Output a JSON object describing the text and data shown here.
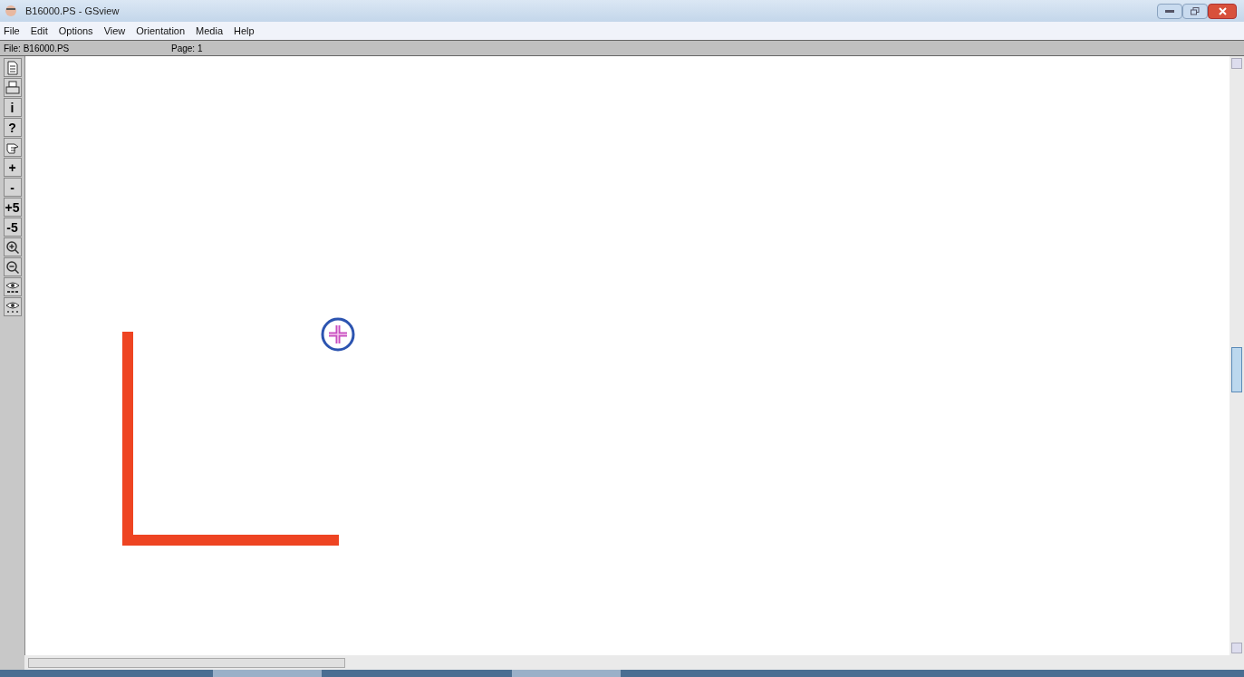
{
  "window": {
    "title": "B16000.PS - GSview"
  },
  "menu": [
    "File",
    "Edit",
    "Options",
    "View",
    "Orientation",
    "Media",
    "Help"
  ],
  "status_bar": {
    "file": "File: B16000.PS",
    "page": "Page: 1"
  },
  "toolbar": [
    {
      "kind": "icon"
    },
    {
      "kind": "icon"
    },
    {
      "kind": "text",
      "label": "i"
    },
    {
      "kind": "text",
      "label": "?"
    },
    {
      "kind": "icon"
    },
    {
      "kind": "text",
      "label": "+"
    },
    {
      "kind": "text",
      "label": "-"
    },
    {
      "kind": "text",
      "label": "+5"
    },
    {
      "kind": "text",
      "label": "-5"
    },
    {
      "kind": "icon"
    },
    {
      "kind": "icon"
    },
    {
      "kind": "icon"
    },
    {
      "kind": "icon"
    }
  ]
}
